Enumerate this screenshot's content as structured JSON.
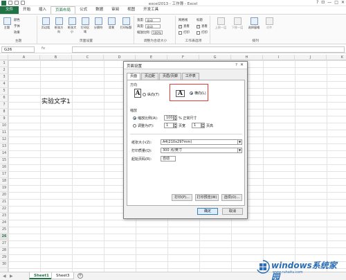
{
  "window": {
    "title": "excel2013 - 工作簿 - Excel",
    "controls": [
      "?",
      "⊡",
      "—",
      "□",
      "✕"
    ]
  },
  "ribbon": {
    "tabs": [
      "文件",
      "开始",
      "插入",
      "页面布局",
      "公式",
      "数据",
      "审阅",
      "视图",
      "开发工具"
    ],
    "active_tab": "页面布局",
    "groups": {
      "theme": {
        "label": "主题",
        "buttons": [
          "主题"
        ],
        "menus": [
          "颜色",
          "字体",
          "效果"
        ]
      },
      "page_setup": {
        "label": "页面设置",
        "buttons": [
          "页边距",
          "纸张方向",
          "纸张大小",
          "打印区域",
          "分隔符",
          "背景",
          "打印标题"
        ]
      },
      "scale_to_fit": {
        "label": "调整为合适大小",
        "width_label": "宽度:",
        "width_value": "自动",
        "height_label": "高度:",
        "height_value": "自动",
        "scale_label": "缩放比例:",
        "scale_value": "100%"
      },
      "sheet_options": {
        "label": "工作表选项",
        "gridlines": "网格线",
        "headings": "标题",
        "view": "查看",
        "print": "打印"
      },
      "arrange": {
        "label": "排列",
        "buttons": [
          "上移一层",
          "下移一层",
          "选择窗格",
          "对齐"
        ]
      }
    }
  },
  "formula_bar": {
    "name_box": "G26",
    "fx": "fx",
    "value": ""
  },
  "grid": {
    "columns": [
      "A",
      "B",
      "C",
      "D",
      "E",
      "F",
      "G",
      "H",
      "I",
      "J",
      "K"
    ],
    "rows": [
      "1",
      "2",
      "3",
      "4",
      "5",
      "6",
      "7",
      "8",
      "9",
      "10",
      "11",
      "12",
      "13",
      "14",
      "15",
      "16",
      "17",
      "18",
      "19",
      "20",
      "21",
      "22",
      "23",
      "24",
      "25",
      "26",
      "27",
      "28",
      "29",
      "30"
    ],
    "selected_row": "26",
    "cell_text": "实验文字1"
  },
  "sheets": {
    "tabs": [
      "Sheet1",
      "Sheet3"
    ],
    "active": "Sheet1",
    "add": "+"
  },
  "dialog": {
    "title": "页面设置",
    "help": "?",
    "close": "✕",
    "tabs": [
      "页面",
      "页边距",
      "页眉/页脚",
      "工作表"
    ],
    "active_tab": "页面",
    "orientation": {
      "section": "方向",
      "portrait": "纵向(T)",
      "landscape": "横向(L)",
      "selected": "landscape"
    },
    "scaling": {
      "section": "缩放",
      "adjust_label": "缩放比例(A):",
      "adjust_value": "100",
      "adjust_suffix": "% 正常尺寸",
      "fit_label": "调整为(F):",
      "fit_wide": "1",
      "fit_wide_suffix": "页宽",
      "fit_tall": "1",
      "fit_tall_suffix": "页高"
    },
    "paper_size_label": "纸张大小(Z):",
    "paper_size_value": "A4(210x297mm)",
    "print_quality_label": "打印质量(Q):",
    "print_quality_value": "300 点/英寸",
    "first_page_label": "起始页码(R):",
    "first_page_value": "自动",
    "buttons": {
      "print": "打印(P)...",
      "preview": "打印预览(W)",
      "options": "选项(O)...",
      "ok": "确定",
      "cancel": "取消"
    }
  },
  "watermark": {
    "main": "windows系统家园",
    "sub": "www.ruhaitu.com"
  },
  "colors": {
    "excel_green": "#217346",
    "highlight_red": "#e53935",
    "watermark_blue": "#2a6db5"
  }
}
